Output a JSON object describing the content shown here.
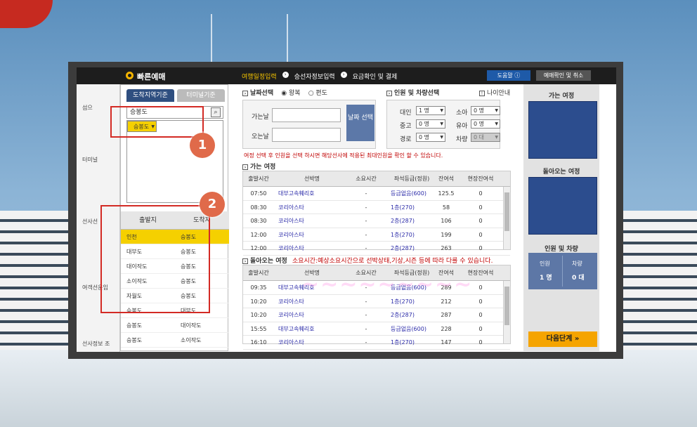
{
  "header": {
    "title": "빠른예매",
    "steps": [
      "여행일정입력",
      "승선자정보입력",
      "요금확인 및 결제"
    ],
    "help": "도움말",
    "check": "예매확인 및 취소"
  },
  "left": {
    "tab_active": "도착지역기준",
    "tab_inactive": "터미널기준",
    "search_value": "승봉도",
    "suggest_selected": "승봉도",
    "table_headers": [
      "출발지",
      "도착지"
    ],
    "rows": [
      {
        "from": "인천",
        "to": "승봉도"
      },
      {
        "from": "대부도",
        "to": "승봉도"
      },
      {
        "from": "대이작도",
        "to": "승봉도"
      },
      {
        "from": "소이작도",
        "to": "승봉도"
      },
      {
        "from": "자월도",
        "to": "승봉도"
      },
      {
        "from": "승봉도",
        "to": "대부도"
      },
      {
        "from": "승봉도",
        "to": "대이작도"
      },
      {
        "from": "승봉도",
        "to": "소이작도"
      }
    ]
  },
  "date": {
    "label": "날짜선택",
    "round": "왕복",
    "oneway": "편도",
    "go_label": "가는날",
    "back_label": "오는날",
    "btn": "날짜 선택"
  },
  "people": {
    "label": "인원 및 차량선택",
    "age_info": "나이안내",
    "adult_l": "대인",
    "adult": "1 명",
    "mid_l": "중고",
    "mid": "0 명",
    "senior_l": "경로",
    "senior": "0 명",
    "child_l": "소아",
    "child": "0 명",
    "baby_l": "유아",
    "baby": "0 명",
    "car_l": "차량",
    "car": "0 대"
  },
  "warn": "여정 선택 후 인원을 선택 하시면 해당선사에 적용된 최대인원을 확인 할 수 있습니다.",
  "go": {
    "label": "가는 여정",
    "headers": [
      "출발시간",
      "선박명",
      "소요시간",
      "좌석등급(정원)",
      "잔여석",
      "현장잔여석"
    ],
    "rows": [
      [
        "07:50",
        "대부고속훼리호",
        "-",
        "등급없음(600)",
        "125.5",
        "0"
      ],
      [
        "08:30",
        "코리아스타",
        "-",
        "1층(270)",
        "58",
        "0"
      ],
      [
        "08:30",
        "코리아스타",
        "-",
        "2층(287)",
        "106",
        "0"
      ],
      [
        "12:00",
        "코리아스타",
        "-",
        "1층(270)",
        "199",
        "0"
      ],
      [
        "12:00",
        "코리아스타",
        "-",
        "2층(287)",
        "263",
        "0"
      ]
    ]
  },
  "back": {
    "label": "돌아오는 여정",
    "note": "소요시간:예상소요시간으로 선박상태,기상,시즌 등에 따라 다를 수 있습니다.",
    "headers": [
      "출발시간",
      "선박명",
      "소요시간",
      "좌석등급(정원)",
      "잔여석",
      "현장잔여석"
    ],
    "rows": [
      [
        "09:35",
        "대부고속훼리호",
        "-",
        "등급없음(600)",
        "289",
        "0"
      ],
      [
        "10:20",
        "코리아스타",
        "-",
        "1층(270)",
        "212",
        "0"
      ],
      [
        "10:20",
        "코리아스타",
        "-",
        "2층(287)",
        "287",
        "0"
      ],
      [
        "15:55",
        "대부고속훼리호",
        "-",
        "등급없음(600)",
        "228",
        "0"
      ],
      [
        "16:10",
        "코리아스타",
        "-",
        "1층(270)",
        "147",
        "0"
      ]
    ]
  },
  "summary": {
    "go": "가는 여정",
    "back": "돌아오는 여정",
    "people": "인원 및 차량",
    "p_label": "인원",
    "p_val": "1 명",
    "c_label": "차량",
    "c_val": "0 대",
    "next": "다음단계 »"
  },
  "strip": {
    "a": "섬으",
    "b": "터미널",
    "c": "선사선",
    "d": "여객선운임",
    "e": "선사정보 조"
  },
  "badges": [
    "1",
    "2"
  ],
  "colors": {
    "accent": "#f5d000",
    "navy": "#2c4d8e",
    "annotation": "#d32a24"
  }
}
